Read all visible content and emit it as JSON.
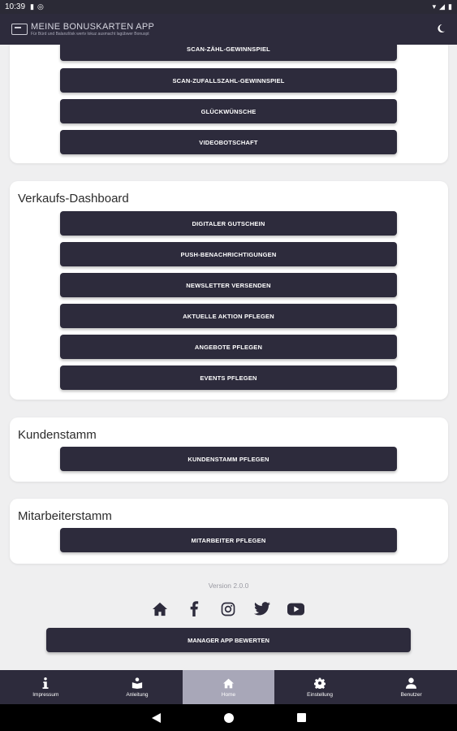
{
  "status_bar": {
    "time": "10:39"
  },
  "app_bar": {
    "logo_title": "MEINE BONUSKARTEN APP",
    "logo_subtitle": "Für Bürd und Balanzlösk wertv lokuz ausmacht lagübwer Bonuspt",
    "theme_icon": "moon-icon"
  },
  "sections": {
    "games": {
      "buttons": [
        "SCAN-ZÄHL-GEWINNSPIEL",
        "SCAN-ZUFALLSZAHL-GEWINNSPIEL",
        "GLÜCKWÜNSCHE",
        "VIDEOBOTSCHAFT"
      ]
    },
    "sales": {
      "title": "Verkaufs-Dashboard",
      "buttons": [
        "DIGITALER GUTSCHEIN",
        "PUSH-BENACHRICHTIGUNGEN",
        "NEWSLETTER VERSENDEN",
        "AKTUELLE AKTION PFLEGEN",
        "ANGEBOTE PFLEGEN",
        "EVENTS PFLEGEN"
      ]
    },
    "customers": {
      "title": "Kundenstamm",
      "buttons": [
        "KUNDENSTAMM PFLEGEN"
      ]
    },
    "staff": {
      "title": "Mitarbeiterstamm",
      "buttons": [
        "MITARBEITER PFLEGEN"
      ]
    }
  },
  "footer": {
    "version": "Version 2.0.0",
    "social_icons": [
      "home-icon",
      "facebook-icon",
      "instagram-icon",
      "twitter-icon",
      "youtube-icon"
    ],
    "rate_button": "MANAGER APP BEWERTEN"
  },
  "tabs": [
    {
      "label": "Impressum",
      "icon": "info-icon"
    },
    {
      "label": "Anleitung",
      "icon": "book-reader-icon"
    },
    {
      "label": "Home",
      "icon": "home-icon",
      "active": true
    },
    {
      "label": "Einstellung",
      "icon": "gear-icon"
    },
    {
      "label": "Benutzer",
      "icon": "user-icon"
    }
  ],
  "colors": {
    "primary": "#2d2b3c",
    "active_tab": "#a8a7b8",
    "background": "#efeff0"
  }
}
